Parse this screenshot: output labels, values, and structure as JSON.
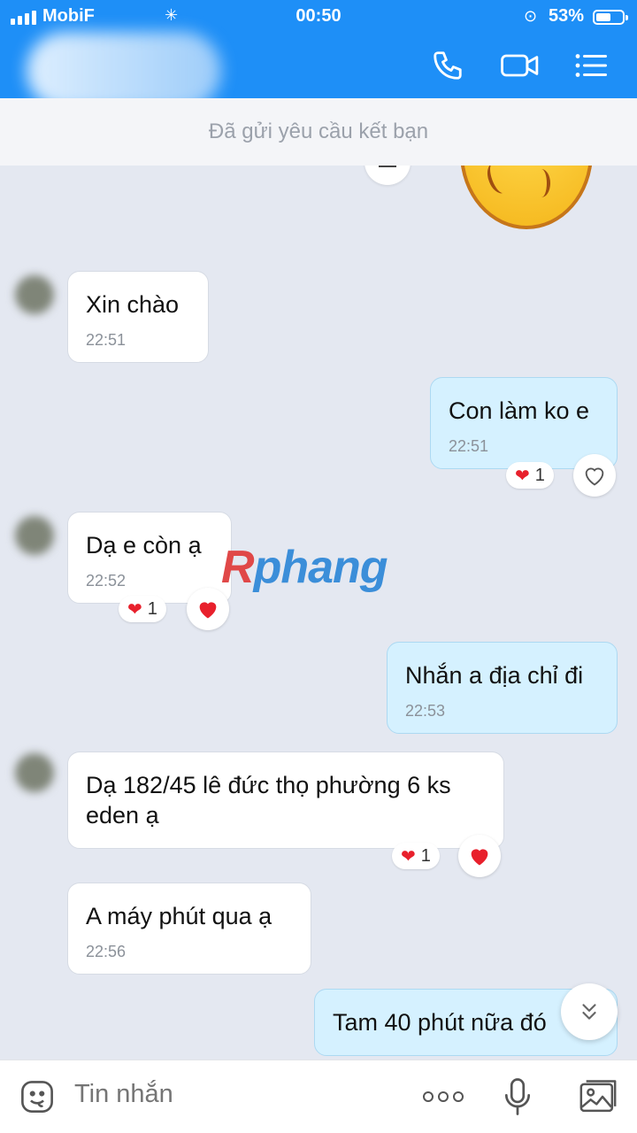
{
  "status_bar": {
    "carrier": "MobiF",
    "time": "00:50",
    "battery": "53%"
  },
  "header": {
    "icons": [
      "phone-icon",
      "video-call-icon",
      "menu-list-icon"
    ]
  },
  "banner": {
    "text": "Đã gửi yêu cầu kết bạn"
  },
  "messages": [
    {
      "side": "them",
      "text": "Xin chào",
      "time": "22:51"
    },
    {
      "side": "me",
      "text": "Con làm ko e",
      "time": "22:51",
      "reaction_count": "1"
    },
    {
      "side": "them",
      "text": "Dạ e còn ạ",
      "time": "22:52",
      "reaction_count": "1"
    },
    {
      "side": "me",
      "text": "Nhắn a địa chỉ đi",
      "time": "22:53"
    },
    {
      "side": "them",
      "text": "Dạ 182/45 lê đức thọ phường 6 ks\neden ạ",
      "reaction_count": "1"
    },
    {
      "side": "them",
      "text": "A máy phút qua ạ",
      "time": "22:56"
    },
    {
      "side": "me",
      "text": "Tam 40 phút nữa đó"
    }
  ],
  "watermark": {
    "part1": "R",
    "part2": "phang"
  },
  "input": {
    "placeholder": "Tin nhắn",
    "icons": [
      "sticker-icon",
      "more-icon",
      "microphone-icon",
      "image-icon"
    ]
  },
  "colors": {
    "header_bg": "#1e8ff7",
    "chat_bg": "#e4e8f1",
    "my_bubble": "#d5f1ff",
    "their_bubble": "#ffffff",
    "heart": "#e8202c"
  }
}
